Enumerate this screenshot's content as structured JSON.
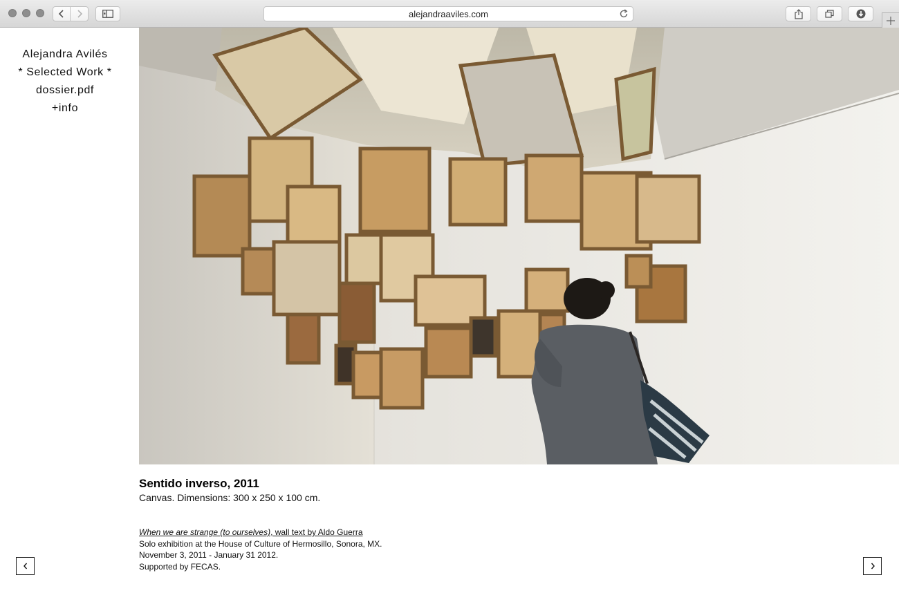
{
  "browser": {
    "url": "alejandraaviles.com",
    "icons": {
      "back": "chevron-left-icon",
      "forward": "chevron-right-icon",
      "sidebar": "sidebar-icon",
      "reload": "reload-icon",
      "share": "share-icon",
      "tabs": "tabs-icon",
      "download": "download-icon",
      "new_tab": "plus-icon"
    }
  },
  "nav": {
    "artist_name": "Alejandra Avilés",
    "selected_work": "* Selected Work *",
    "dossier": "dossier.pdf",
    "info": "+info"
  },
  "artwork": {
    "title": "Sentido inverso, 2011",
    "meta": "Canvas. Dimensions: 300 x 250 x 100 cm.",
    "wall_text_title": "When we are strange (to ourselves)",
    "wall_text_author": ", wall text by Aldo Guerra",
    "line1": "Solo exhibition at the House of Culture of Hermosillo, Sonora, MX.",
    "line2": "November 3, 2011 - January 31 2012.",
    "line3": "Supported by FECAS."
  },
  "pager": {
    "prev_icon": "chevron-left-icon",
    "next_icon": "chevron-right-icon"
  }
}
